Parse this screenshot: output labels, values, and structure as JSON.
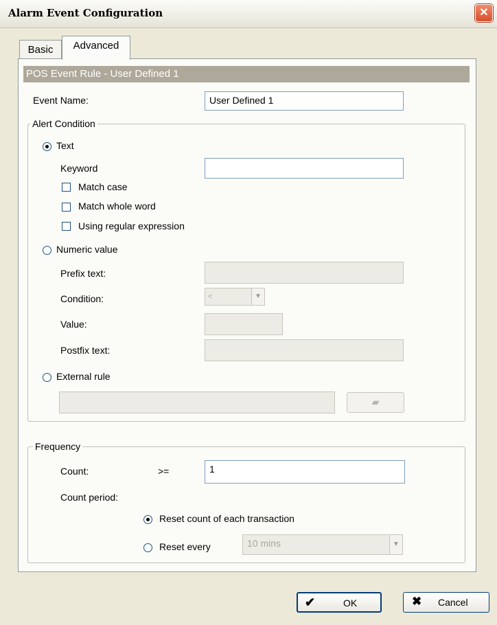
{
  "window": {
    "title": "Alarm Event Configuration"
  },
  "tabs": {
    "basic": "Basic",
    "advanced": "Advanced"
  },
  "rule_header": "POS Event Rule - User Defined 1",
  "event_name": {
    "label": "Event Name:",
    "value": "User Defined 1"
  },
  "alert_condition": {
    "legend": "Alert Condition",
    "text_option": "Text",
    "keyword_label": "Keyword",
    "keyword_value": "",
    "match_case": "Match case",
    "match_whole_word": "Match whole word",
    "using_regex": "Using regular expression",
    "numeric_option": "Numeric value",
    "prefix_label": "Prefix text:",
    "condition_label": "Condition:",
    "condition_value": "<",
    "value_label": "Value:",
    "postfix_label": "Postfix text:",
    "external_option": "External rule"
  },
  "frequency": {
    "legend": "Frequency",
    "count_label": "Count:",
    "operator": ">=",
    "count_value": "1",
    "period_label": "Count period:",
    "reset_each": "Reset count of each transaction",
    "reset_every": "Reset every",
    "reset_every_value": "10 mins"
  },
  "buttons": {
    "ok": "OK",
    "cancel": "Cancel"
  }
}
